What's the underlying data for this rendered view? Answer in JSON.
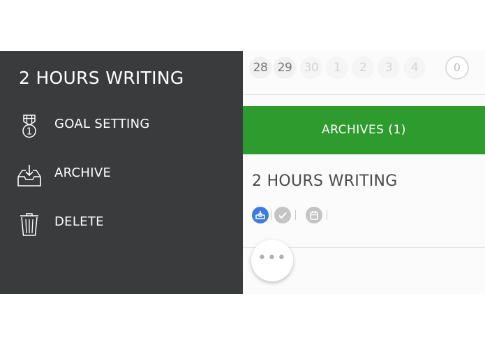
{
  "menu": {
    "title": "2 HOURS WRITING",
    "items": [
      {
        "label": "GOAL SETTING",
        "icon": "medal-icon"
      },
      {
        "label": "ARCHIVE",
        "icon": "archive-tray-icon"
      },
      {
        "label": "DELETE",
        "icon": "trash-icon"
      }
    ]
  },
  "calendar": {
    "days": [
      "28",
      "29",
      "30",
      "1",
      "2",
      "3",
      "4"
    ],
    "count": "0"
  },
  "archives": {
    "label": "ARCHIVES (1)"
  },
  "task": {
    "title": "2 HOURS WRITING",
    "icons": [
      "archive-icon",
      "check-icon",
      "calendar-icon"
    ]
  },
  "more_button": {
    "label": "•••"
  },
  "colors": {
    "menu_bg": "#3a3b3d",
    "accent_green": "#2e9b2e",
    "archive_blue": "#3d7be0"
  }
}
